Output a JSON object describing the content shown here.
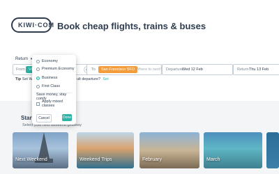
{
  "brand": {
    "logo_text": "KIWI·COM"
  },
  "hero": {
    "title": "Book cheap flights, trains & buses"
  },
  "search": {
    "trip_type": "Return",
    "from_label": "From",
    "from_value": "Vie",
    "to_label": "To",
    "to_value": "San Francisco SFO",
    "to_placeholder": "Where to next?",
    "departure_label": "Departure",
    "departure_value": "Wed 12 Feb",
    "return_label": "Return",
    "return_value": "Thu 13 Feb"
  },
  "tip": {
    "prefix": "Tip",
    "text": "Set We",
    "question": "ult departure?",
    "link": "Set"
  },
  "cabin_dropdown": {
    "options": [
      {
        "label": "Economy",
        "checked": false
      },
      {
        "label": "Premium Economy",
        "checked": false
      },
      {
        "label": "Business",
        "checked": true
      },
      {
        "label": "First Class",
        "checked": false
      }
    ],
    "hint": "Save money, stay comfy",
    "mixed_label": "Apply mixed classes",
    "cancel": "Cancel",
    "done": "Done"
  },
  "explore": {
    "title": "Start a n",
    "subtitle": "Select your next weekend getaway"
  },
  "cards": [
    {
      "label": "Next Weekend"
    },
    {
      "label": "Weekend Trips"
    },
    {
      "label": "February"
    },
    {
      "label": "March"
    },
    {
      "label": ""
    }
  ],
  "colors": {
    "accent": "#2bb3a6",
    "to_chip": "#f39c3a",
    "text_dark": "#2d3d4f"
  }
}
